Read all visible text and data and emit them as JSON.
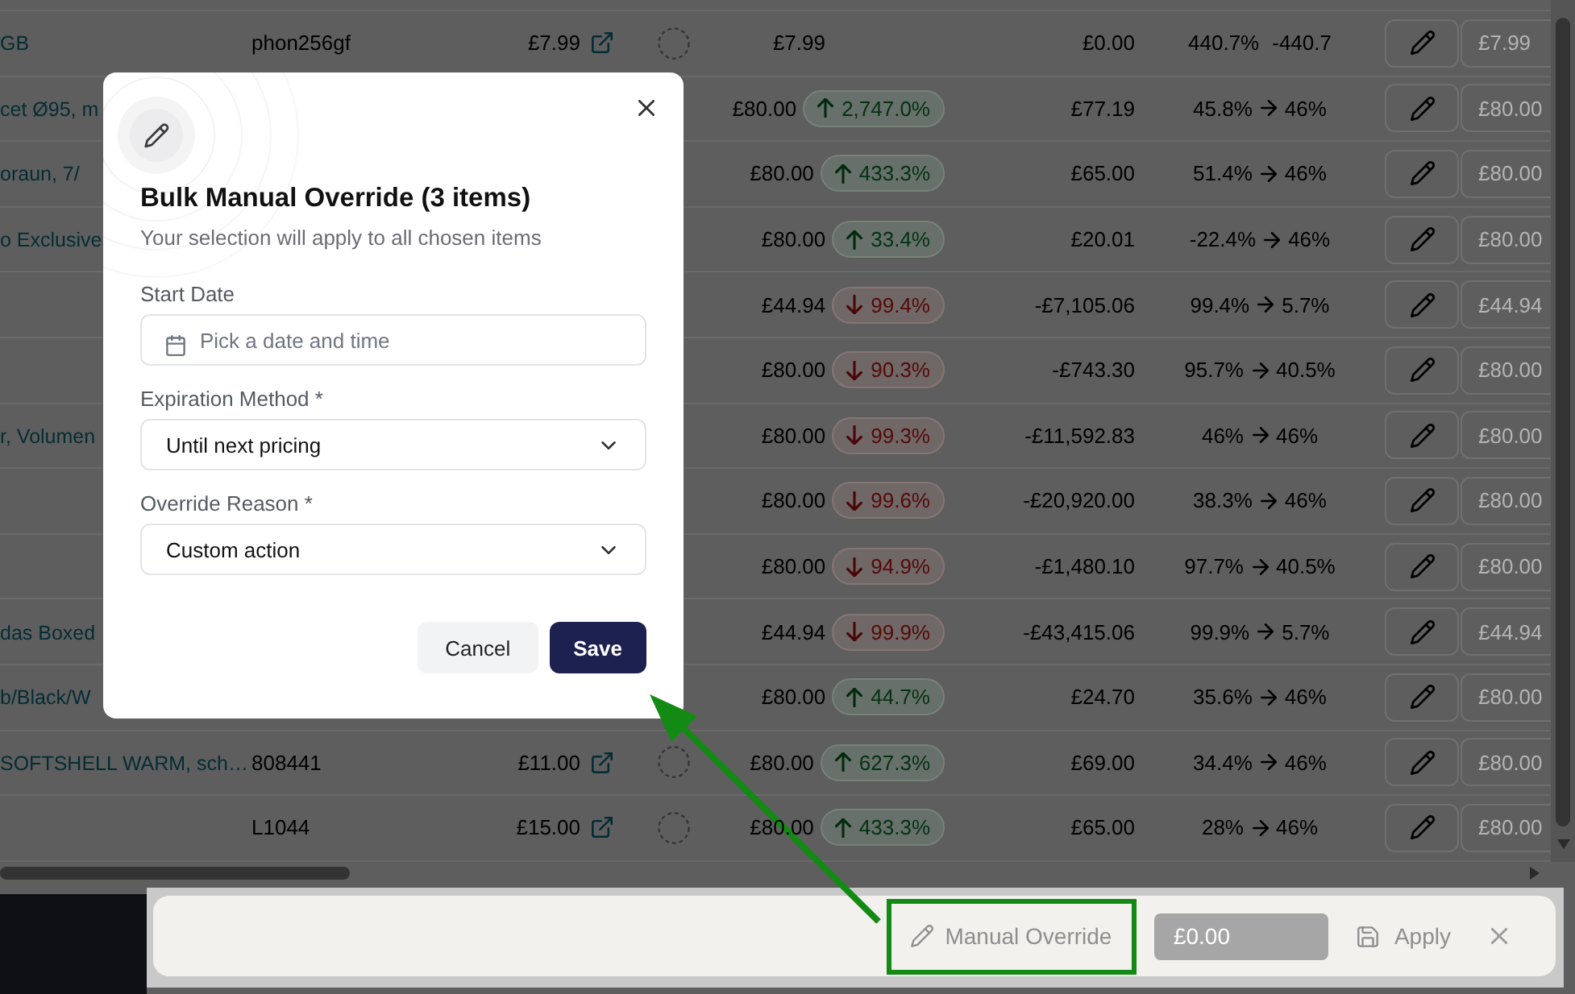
{
  "table": {
    "rows": [
      {
        "name": "GB",
        "sku": "phon256gf",
        "price": "£7.99",
        "current_price": "£7.99",
        "cost": "£0.00",
        "margin": {
          "kind": "pair",
          "from": "440.7%",
          "to": "-440.7"
        },
        "override_placeholder": "£7.99"
      },
      {
        "name": "cet Ø95, m",
        "current_price": "£80.00",
        "change": {
          "increase": true,
          "value": "2,747.0%"
        },
        "cost": "£77.19",
        "margin": {
          "kind": "transition",
          "from": "45.8%",
          "to": "46%"
        },
        "override_placeholder": "£80.00"
      },
      {
        "name": "oraun, 7/",
        "current_price": "£80.00",
        "change": {
          "increase": true,
          "value": "433.3%"
        },
        "cost": "£65.00",
        "margin": {
          "kind": "transition",
          "from": "51.4%",
          "to": "46%"
        },
        "override_placeholder": "£80.00"
      },
      {
        "name": "o Exclusive",
        "current_price": "£80.00",
        "change": {
          "increase": true,
          "value": "33.4%"
        },
        "cost": "£20.01",
        "margin": {
          "kind": "transition",
          "from": "-22.4%",
          "to": "46%"
        },
        "override_placeholder": "£80.00"
      },
      {
        "current_price": "£44.94",
        "change": {
          "increase": false,
          "value": "99.4%"
        },
        "cost": "-£7,105.06",
        "margin": {
          "kind": "transition",
          "from": "99.4%",
          "to": "5.7%"
        },
        "override_placeholder": "£44.94"
      },
      {
        "current_price": "£80.00",
        "change": {
          "increase": false,
          "value": "90.3%"
        },
        "cost": "-£743.30",
        "margin": {
          "kind": "transition",
          "from": "95.7%",
          "to": "40.5%"
        },
        "override_placeholder": "£80.00"
      },
      {
        "name": "r, Volumen",
        "current_price": "£80.00",
        "change": {
          "increase": false,
          "value": "99.3%"
        },
        "cost": "-£11,592.83",
        "margin": {
          "kind": "transition",
          "from": "46%",
          "to": "46%"
        },
        "override_placeholder": "£80.00"
      },
      {
        "current_price": "£80.00",
        "change": {
          "increase": false,
          "value": "99.6%"
        },
        "cost": "-£20,920.00",
        "margin": {
          "kind": "transition",
          "from": "38.3%",
          "to": "46%"
        },
        "override_placeholder": "£80.00"
      },
      {
        "current_price": "£80.00",
        "change": {
          "increase": false,
          "value": "94.9%"
        },
        "cost": "-£1,480.10",
        "margin": {
          "kind": "transition",
          "from": "97.7%",
          "to": "40.5%"
        },
        "override_placeholder": "£80.00"
      },
      {
        "name": "das Boxed",
        "current_price": "£44.94",
        "change": {
          "increase": false,
          "value": "99.9%"
        },
        "cost": "-£43,415.06",
        "margin": {
          "kind": "transition",
          "from": "99.9%",
          "to": "5.7%"
        },
        "override_placeholder": "£44.94"
      },
      {
        "name": "b/Black/W",
        "current_price": "£80.00",
        "change": {
          "increase": true,
          "value": "44.7%"
        },
        "cost": "£24.70",
        "margin": {
          "kind": "transition",
          "from": "35.6%",
          "to": "46%"
        },
        "override_placeholder": "£80.00"
      },
      {
        "name": "SOFTSHELL WARM, sch…",
        "sku": "808441",
        "price": "£11.00",
        "current_price": "£80.00",
        "change": {
          "increase": true,
          "value": "627.3%"
        },
        "cost": "£69.00",
        "margin": {
          "kind": "transition",
          "from": "34.4%",
          "to": "46%"
        },
        "override_placeholder": "£80.00"
      },
      {
        "sku": "L1044",
        "price": "£15.00",
        "current_price": "£80.00",
        "change": {
          "increase": true,
          "value": "433.3%"
        },
        "cost": "£65.00",
        "margin": {
          "kind": "transition",
          "from": "28%",
          "to": "46%"
        },
        "override_placeholder": "£80.00"
      }
    ]
  },
  "modal": {
    "title": "Bulk Manual Override (3 items)",
    "subtitle": "Your selection will apply to all chosen items",
    "fields": [
      {
        "kind": "date",
        "label": "Start Date",
        "placeholder": "Pick a date and time"
      },
      {
        "kind": "select",
        "label": "Expiration Method *",
        "value": "Until next pricing"
      },
      {
        "kind": "select",
        "label": "Override Reason *",
        "value": "Custom action"
      }
    ],
    "buttons": [
      {
        "kind": "secondary",
        "label": "Cancel"
      },
      {
        "kind": "primary",
        "label": "Save"
      }
    ]
  },
  "bottom_bar": {
    "manual_override": {
      "label": "Manual Override",
      "disabled": true,
      "highlighted": true
    },
    "price_field": {
      "value": "£0.00",
      "disabled": true
    },
    "apply_button": {
      "label": "Apply",
      "disabled": true
    }
  }
}
